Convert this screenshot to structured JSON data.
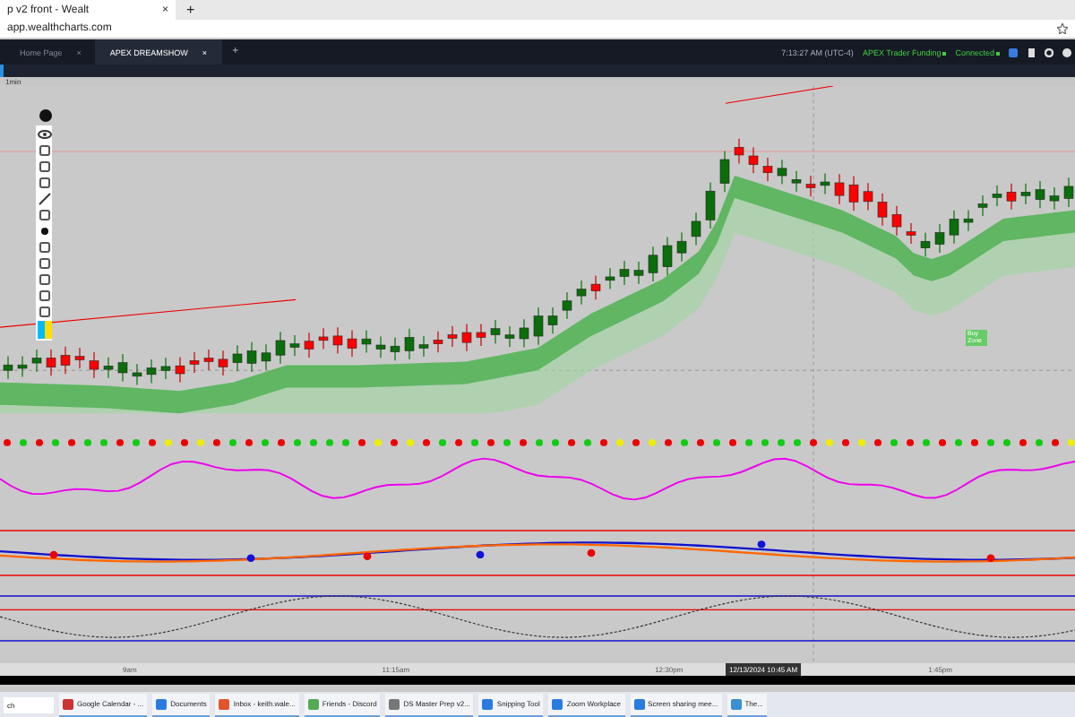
{
  "browser": {
    "tab_title": "p v2 front - Wealt",
    "tab_close": "×",
    "new_tab": "+",
    "address": "app.wealthcharts.com"
  },
  "app_tabs": [
    {
      "label": "Home Page",
      "selected": false,
      "close": "×"
    },
    {
      "label": "APEX DREAMSHOW",
      "selected": true,
      "close": "×"
    }
  ],
  "add_tab": "+",
  "status": {
    "time": "7:13:27 AM (UTC-4)",
    "account": "APEX Trader Funding",
    "connection": "Connected"
  },
  "symbol_bar": {
    "interval": "1min"
  },
  "chart": {
    "signal_label": "Buy Zone",
    "time_labels": [
      "9am",
      "11:15am",
      "12:30pm",
      "1:45pm"
    ],
    "crosshair_time": "12/13/2024 10:45 AM"
  },
  "taskbar": {
    "search": "ch",
    "items": [
      {
        "label": "Google Calendar - ..."
      },
      {
        "label": "Documents"
      },
      {
        "label": "Inbox - keith.wale..."
      },
      {
        "label": "Friends - Discord"
      },
      {
        "label": "DS Master Prep v2..."
      },
      {
        "label": "Snipping Tool"
      },
      {
        "label": "Zoom Workplace"
      },
      {
        "label": "Screen sharing mee..."
      },
      {
        "label": "The..."
      }
    ]
  }
}
